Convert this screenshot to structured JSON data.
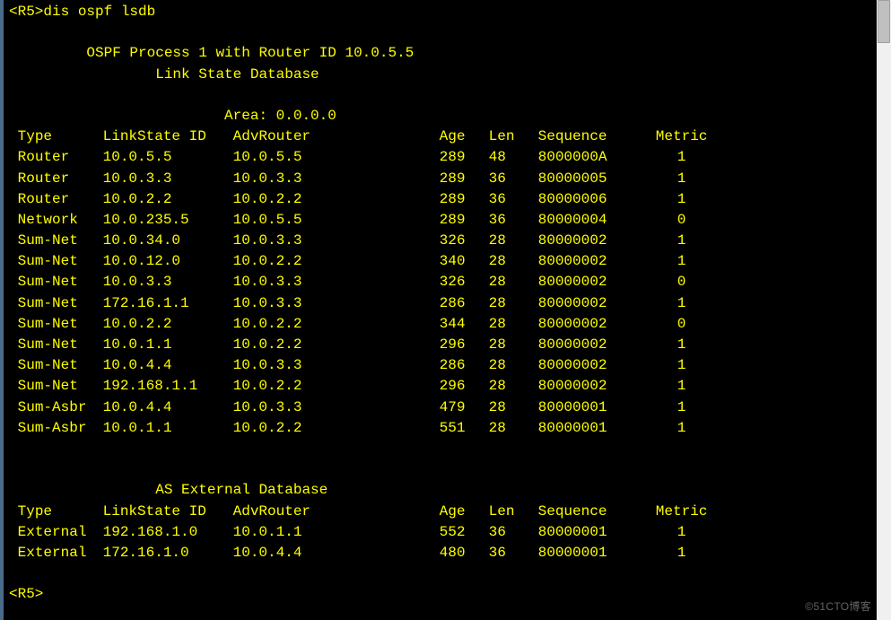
{
  "prompt1": "<R5>dis ospf lsdb",
  "prompt2": "<R5>",
  "blank": "",
  "process_line": "         OSPF Process 1 with Router ID 10.0.5.5",
  "lsdb_title": "                 Link State Database",
  "area_line": "                         Area: 0.0.0.0",
  "header": {
    "type": "Type",
    "linkstate": "LinkState ID",
    "advrouter": "AdvRouter",
    "age": "Age",
    "len": "Len",
    "sequence": "Sequence",
    "metric": "Metric"
  },
  "rows": [
    {
      "type": "Router",
      "ls": "10.0.5.5",
      "adv": "10.0.5.5",
      "age": "289",
      "len": "48",
      "seq": "8000000A",
      "met": "1"
    },
    {
      "type": "Router",
      "ls": "10.0.3.3",
      "adv": "10.0.3.3",
      "age": "289",
      "len": "36",
      "seq": "80000005",
      "met": "1"
    },
    {
      "type": "Router",
      "ls": "10.0.2.2",
      "adv": "10.0.2.2",
      "age": "289",
      "len": "36",
      "seq": "80000006",
      "met": "1"
    },
    {
      "type": "Network",
      "ls": "10.0.235.5",
      "adv": "10.0.5.5",
      "age": "289",
      "len": "36",
      "seq": "80000004",
      "met": "0"
    },
    {
      "type": "Sum-Net",
      "ls": "10.0.34.0",
      "adv": "10.0.3.3",
      "age": "326",
      "len": "28",
      "seq": "80000002",
      "met": "1"
    },
    {
      "type": "Sum-Net",
      "ls": "10.0.12.0",
      "adv": "10.0.2.2",
      "age": "340",
      "len": "28",
      "seq": "80000002",
      "met": "1"
    },
    {
      "type": "Sum-Net",
      "ls": "10.0.3.3",
      "adv": "10.0.3.3",
      "age": "326",
      "len": "28",
      "seq": "80000002",
      "met": "0"
    },
    {
      "type": "Sum-Net",
      "ls": "172.16.1.1",
      "adv": "10.0.3.3",
      "age": "286",
      "len": "28",
      "seq": "80000002",
      "met": "1"
    },
    {
      "type": "Sum-Net",
      "ls": "10.0.2.2",
      "adv": "10.0.2.2",
      "age": "344",
      "len": "28",
      "seq": "80000002",
      "met": "0"
    },
    {
      "type": "Sum-Net",
      "ls": "10.0.1.1",
      "adv": "10.0.2.2",
      "age": "296",
      "len": "28",
      "seq": "80000002",
      "met": "1"
    },
    {
      "type": "Sum-Net",
      "ls": "10.0.4.4",
      "adv": "10.0.3.3",
      "age": "286",
      "len": "28",
      "seq": "80000002",
      "met": "1"
    },
    {
      "type": "Sum-Net",
      "ls": "192.168.1.1",
      "adv": "10.0.2.2",
      "age": "296",
      "len": "28",
      "seq": "80000002",
      "met": "1"
    },
    {
      "type": "Sum-Asbr",
      "ls": "10.0.4.4",
      "adv": "10.0.3.3",
      "age": "479",
      "len": "28",
      "seq": "80000001",
      "met": "1"
    },
    {
      "type": "Sum-Asbr",
      "ls": "10.0.1.1",
      "adv": "10.0.2.2",
      "age": "551",
      "len": "28",
      "seq": "80000001",
      "met": "1"
    }
  ],
  "ext_title": "                 AS External Database",
  "ext_rows": [
    {
      "type": "External",
      "ls": "192.168.1.0",
      "adv": "10.0.1.1",
      "age": "552",
      "len": "36",
      "seq": "80000001",
      "met": "1"
    },
    {
      "type": "External",
      "ls": "172.16.1.0",
      "adv": "10.0.4.4",
      "age": "480",
      "len": "36",
      "seq": "80000001",
      "met": "1"
    }
  ],
  "watermark": "©51CTO博客"
}
